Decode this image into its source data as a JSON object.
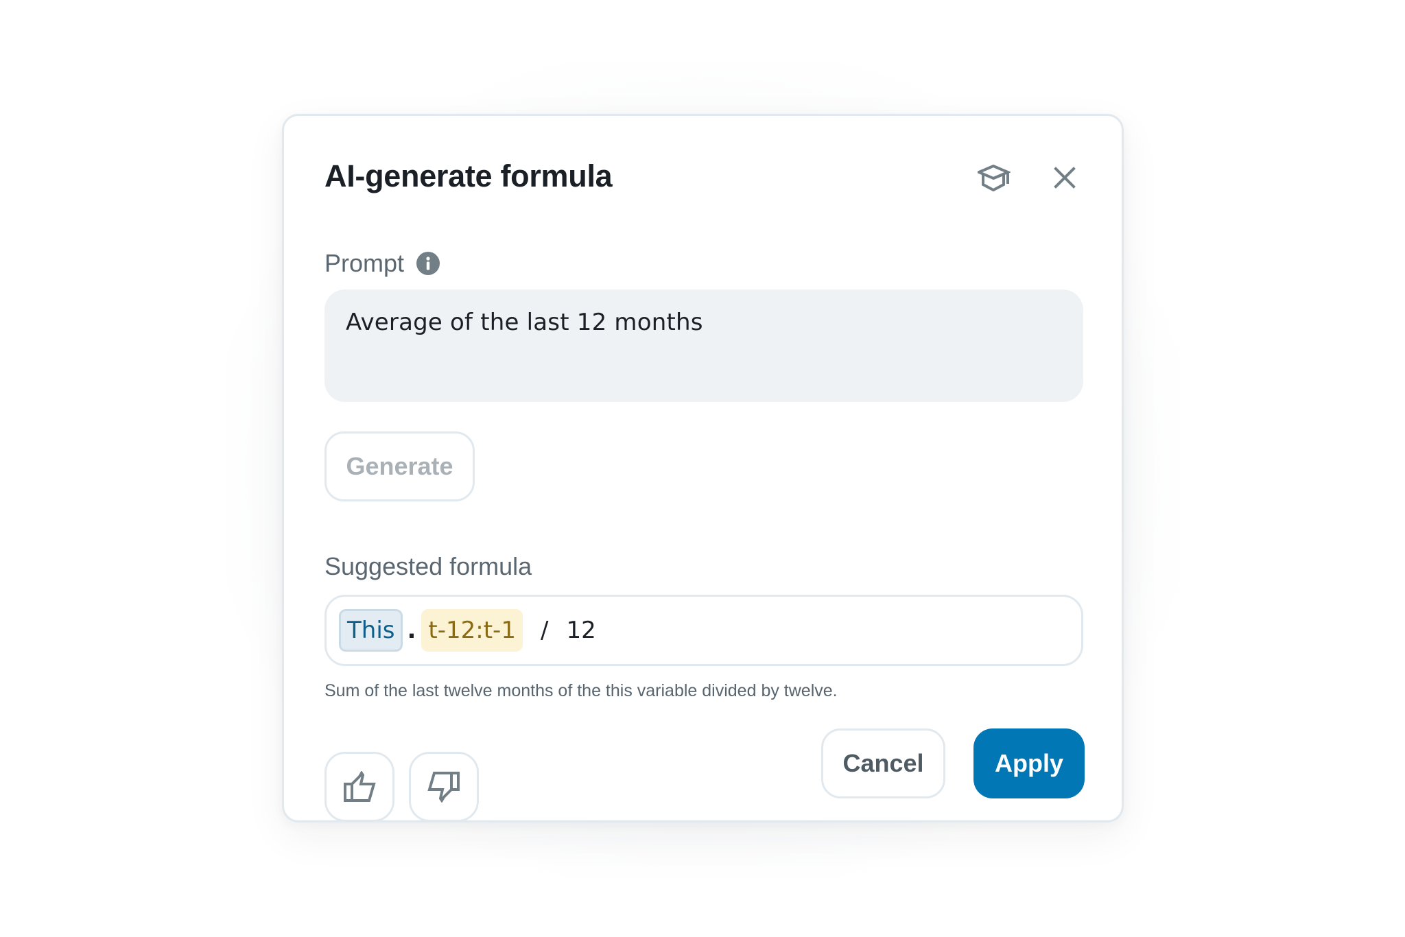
{
  "dialog": {
    "title": "AI-generate formula",
    "icons": {
      "learn": "graduation-cap-icon",
      "close": "close-icon",
      "info": "info-icon",
      "thumbs_up": "thumbs-up-icon",
      "thumbs_down": "thumbs-down-icon"
    },
    "prompt": {
      "label": "Prompt",
      "value": "Average of the last 12 months"
    },
    "generate_label": "Generate",
    "suggested": {
      "label": "Suggested formula",
      "tokens": {
        "variable": "This",
        "dot": ".",
        "range": "t-12:t-1",
        "operator": "/",
        "number": "12"
      },
      "explanation": "Sum of the last twelve months of the this variable divided by twelve."
    },
    "actions": {
      "cancel_label": "Cancel",
      "apply_label": "Apply"
    }
  },
  "colors": {
    "primary": "#0277b5",
    "variable_token_text": "#0e5f8c",
    "variable_token_bg": "#e3ecf2",
    "range_token_text": "#8a6a12",
    "range_token_bg": "#fcf2d4",
    "icon_gray": "#737f86"
  }
}
